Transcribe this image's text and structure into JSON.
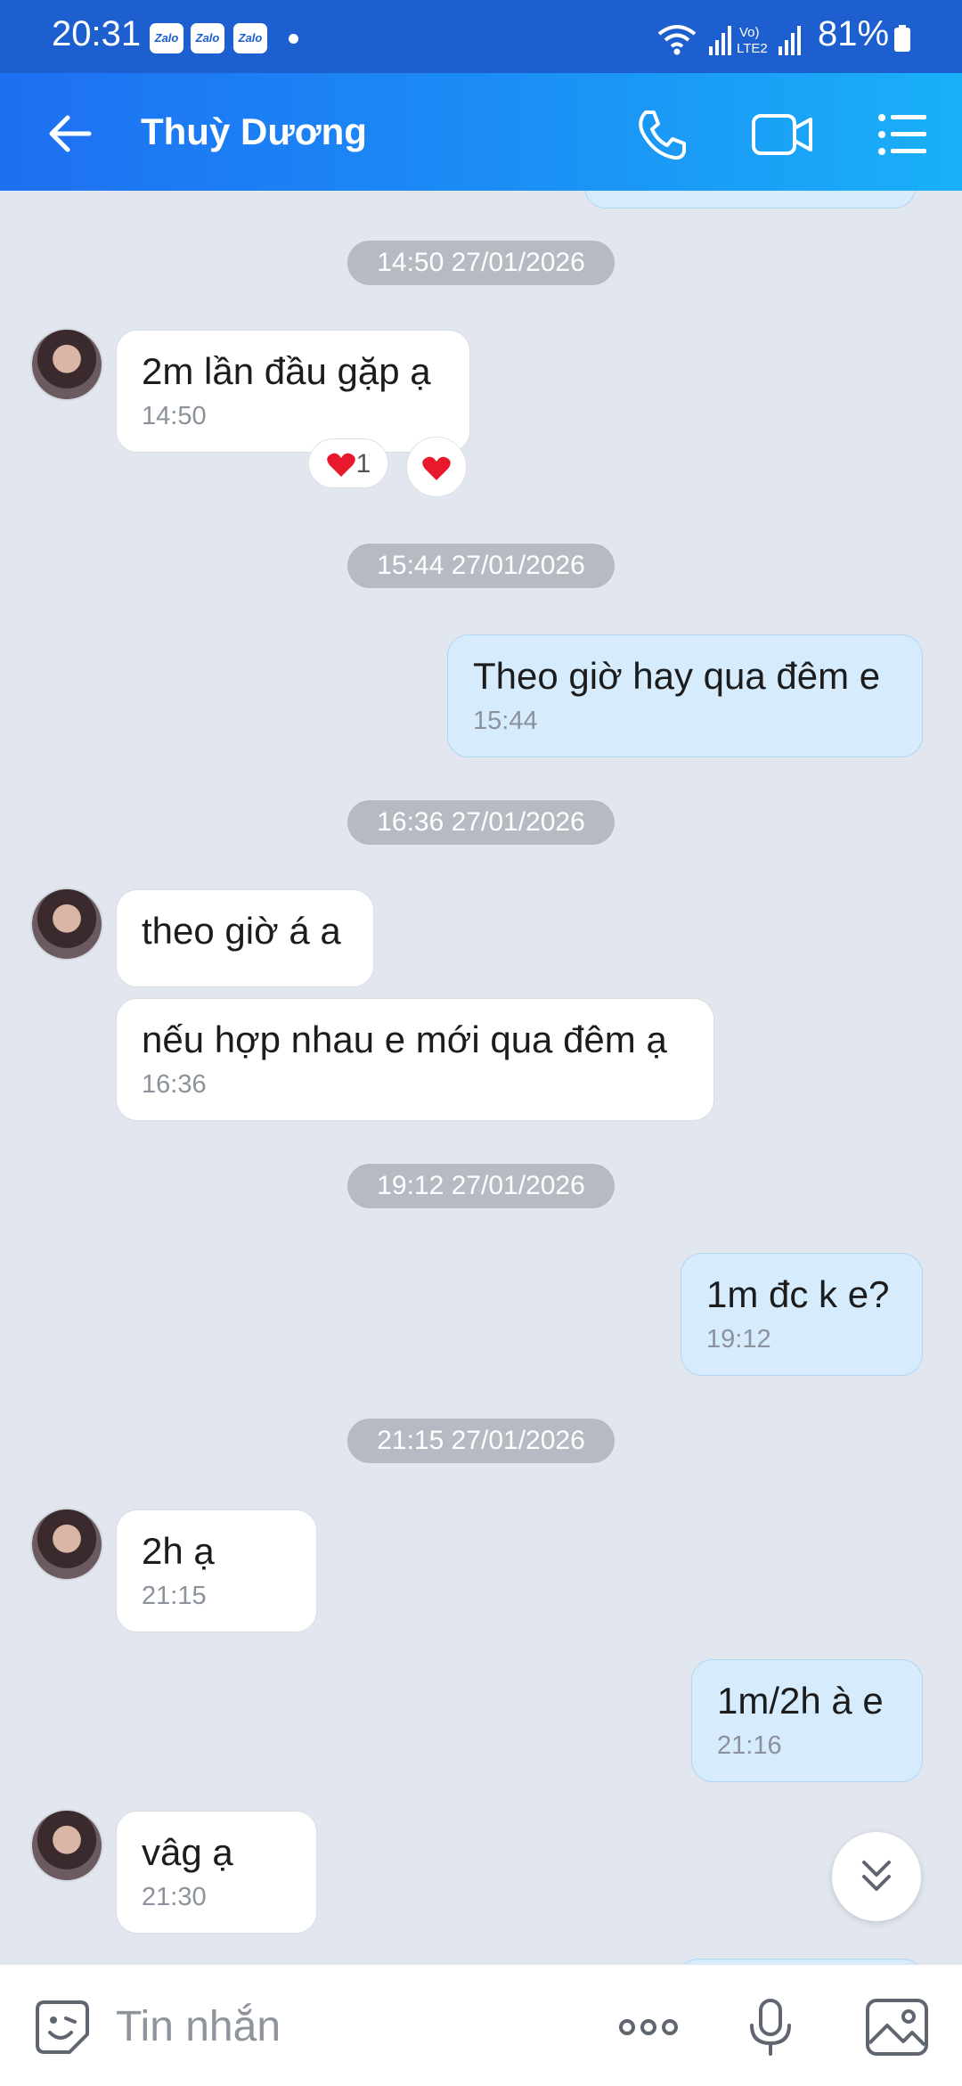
{
  "status_bar": {
    "time": "20:31",
    "apps": [
      "Zalo",
      "Zalo",
      "Zalo"
    ],
    "network_label_top": "Vo)",
    "network_label_bottom": "LTE2",
    "battery": "81%"
  },
  "header": {
    "contact_name": "Thuỳ Dương",
    "icons": [
      "back-arrow-icon",
      "phone-icon",
      "video-call-icon",
      "menu-list-icon"
    ]
  },
  "chat": {
    "date_separators": [
      "14:50 27/01/2026",
      "15:44 27/01/2026",
      "16:36 27/01/2026",
      "19:12 27/01/2026",
      "21:15 27/01/2026"
    ],
    "messages": [
      {
        "direction": "incoming",
        "text": "2m lần đầu gặp ạ",
        "time": "14:50"
      },
      {
        "direction": "outgoing",
        "text": "Theo giờ hay qua đêm e",
        "time": "15:44"
      },
      {
        "direction": "incoming",
        "text": "theo giờ á a",
        "time": ""
      },
      {
        "direction": "incoming",
        "text": "nếu hợp nhau e mới qua đêm ạ",
        "time": "16:36"
      },
      {
        "direction": "outgoing",
        "text": "1m đc k e?",
        "time": "19:12"
      },
      {
        "direction": "incoming",
        "text": "2h ạ",
        "time": "21:15"
      },
      {
        "direction": "outgoing",
        "text": "1m/2h à e",
        "time": "21:16"
      },
      {
        "direction": "incoming",
        "text": "vâg ạ",
        "time": "21:30"
      }
    ],
    "reaction": {
      "count": "1",
      "color": "#e8192c"
    }
  },
  "composer": {
    "placeholder": "Tin nhắn",
    "icons": [
      "sticker-icon",
      "more-options-icon",
      "microphone-icon",
      "image-icon"
    ]
  },
  "colors": {
    "header_start": "#1e6ff2",
    "header_end": "#1ab0f8",
    "chat_background": "#e2e7ef",
    "outgoing_bubble": "#d6ecfd",
    "incoming_bubble": "#ffffff"
  }
}
